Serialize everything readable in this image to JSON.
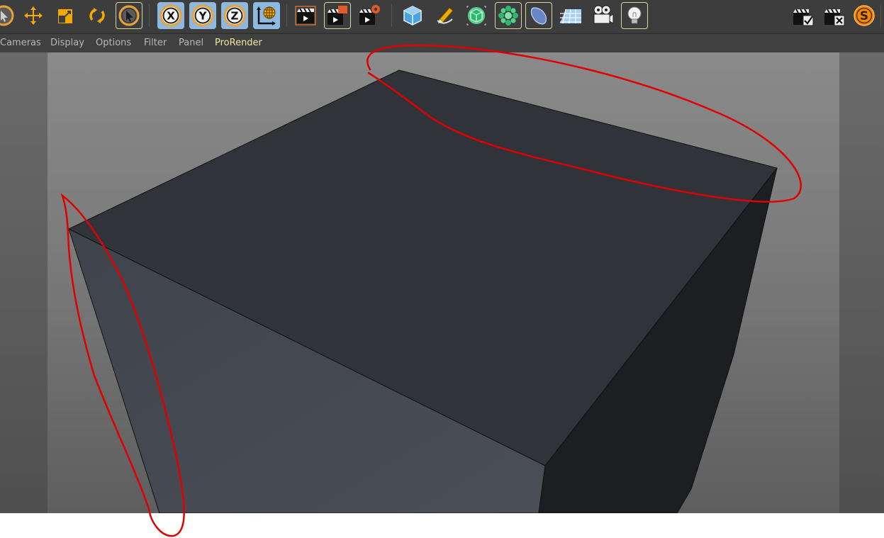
{
  "menubar": {
    "items": [
      "Cameras",
      "Display",
      "Options",
      "Filter",
      "Panel",
      "ProRender"
    ]
  },
  "toolbar": {
    "icons": [
      "live-selection-icon",
      "move-icon",
      "scale-icon",
      "rotate-icon",
      "recent-tool-icon",
      "x-axis-icon",
      "y-axis-icon",
      "z-axis-icon",
      "world-coordinate-icon",
      "render-view-icon",
      "render-to-picture-viewer-icon",
      "render-settings-icon",
      "cube-icon",
      "pen-icon",
      "subdivision-icon",
      "cloner-icon",
      "deformer-icon",
      "floor-icon",
      "camera-icon",
      "light-icon",
      "render-queue-add-icon",
      "render-queue-remove-icon",
      "s-plugin-icon"
    ],
    "axis_labels": {
      "x": "X",
      "y": "Y",
      "z": "Z"
    },
    "s_label": "S"
  },
  "colors": {
    "toolbar_bg": "#3d3d3d",
    "accent_yellow": "#f2a900",
    "axis_blue": "#8fb8e0",
    "annotation_red": "#e00000",
    "viewport_center": "#8a8a8a"
  }
}
